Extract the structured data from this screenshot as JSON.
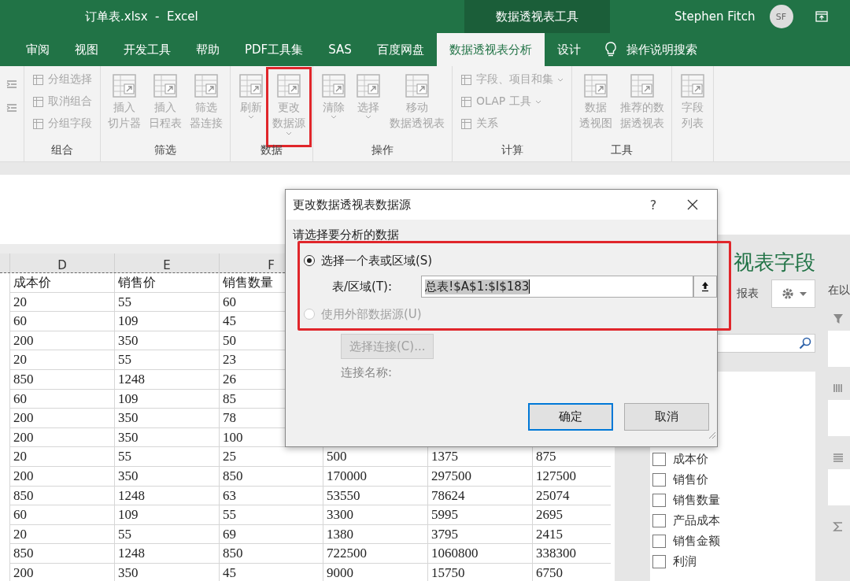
{
  "window": {
    "title": "订单表.xlsx  -  Excel",
    "context_title": "数据透视表工具",
    "user": "Stephen Fitch",
    "avatar": "SF"
  },
  "tabs": [
    {
      "label": "审阅",
      "selected": false
    },
    {
      "label": "视图",
      "selected": false
    },
    {
      "label": "开发工具",
      "selected": false
    },
    {
      "label": "帮助",
      "selected": false
    },
    {
      "label": "PDF工具集",
      "selected": false
    },
    {
      "label": "SAS",
      "selected": false
    },
    {
      "label": "百度网盘",
      "selected": false
    },
    {
      "label": "数据透视表分析",
      "selected": true
    },
    {
      "label": "设计",
      "selected": false
    }
  ],
  "tell_me": "操作说明搜索",
  "ribbon": {
    "groups": [
      {
        "items": [
          {
            "kind": "icon"
          },
          {
            "kind": "icon"
          }
        ]
      },
      {
        "label": "组合",
        "items": [
          {
            "kind": "small",
            "label": "分组选择",
            "disabled": true
          },
          {
            "kind": "small",
            "label": "取消组合",
            "disabled": true
          },
          {
            "kind": "small",
            "label": "分组字段",
            "disabled": true
          }
        ]
      },
      {
        "label": "筛选",
        "items": [
          {
            "kind": "large",
            "lines": [
              "插入",
              "切片器"
            ],
            "disabled": true
          },
          {
            "kind": "large",
            "lines": [
              "插入",
              "日程表"
            ],
            "disabled": true
          },
          {
            "kind": "large",
            "lines": [
              "筛选",
              "器连接"
            ],
            "disabled": true
          }
        ]
      },
      {
        "label": "数据",
        "items": [
          {
            "kind": "large",
            "lines": [
              "刷新"
            ],
            "dropdown": true,
            "disabled": true
          },
          {
            "kind": "large",
            "lines": [
              "更改",
              "数据源"
            ],
            "dropdown": true,
            "disabled": true,
            "highlighted": true
          }
        ]
      },
      {
        "label": "操作",
        "items": [
          {
            "kind": "large",
            "lines": [
              "清除"
            ],
            "dropdown": true,
            "disabled": true
          },
          {
            "kind": "large",
            "lines": [
              "选择"
            ],
            "dropdown": true,
            "disabled": true
          },
          {
            "kind": "large",
            "lines": [
              "移动",
              "数据透视表"
            ],
            "disabled": true
          }
        ]
      },
      {
        "label": "计算",
        "items": [
          {
            "kind": "small",
            "label": "字段、项目和集",
            "dropdown": true,
            "disabled": true
          },
          {
            "kind": "small",
            "label": "OLAP 工具",
            "dropdown": true,
            "disabled": true
          },
          {
            "kind": "small",
            "label": "关系",
            "disabled": true
          }
        ]
      },
      {
        "label": "工具",
        "items": [
          {
            "kind": "large",
            "lines": [
              "数据",
              "透视图"
            ],
            "disabled": true
          },
          {
            "kind": "large",
            "lines": [
              "推荐的数",
              "据透视表"
            ],
            "disabled": true
          }
        ]
      },
      {
        "items": [
          {
            "kind": "large",
            "lines": [
              "字段",
              "列表"
            ],
            "disabled": true
          }
        ]
      }
    ]
  },
  "sheet": {
    "columns": [
      "D",
      "E",
      "F"
    ],
    "rows": [
      [
        "成本价",
        "销售价",
        "销售数量",
        null,
        null,
        null
      ],
      [
        "20",
        "55",
        "60",
        null,
        null,
        null
      ],
      [
        "60",
        "109",
        "45",
        null,
        null,
        null
      ],
      [
        "200",
        "350",
        "50",
        null,
        null,
        null
      ],
      [
        "20",
        "55",
        "23",
        null,
        null,
        null
      ],
      [
        "850",
        "1248",
        "26",
        null,
        null,
        null
      ],
      [
        "60",
        "109",
        "85",
        null,
        null,
        null
      ],
      [
        "200",
        "350",
        "78",
        null,
        null,
        null
      ],
      [
        "200",
        "350",
        "100",
        null,
        null,
        null
      ],
      [
        "20",
        "55",
        "25",
        "500",
        "1375",
        "875"
      ],
      [
        "200",
        "350",
        "850",
        "170000",
        "297500",
        "127500"
      ],
      [
        "850",
        "1248",
        "63",
        "53550",
        "78624",
        "25074"
      ],
      [
        "60",
        "109",
        "55",
        "3300",
        "5995",
        "2695"
      ],
      [
        "20",
        "55",
        "69",
        "1380",
        "3795",
        "2415"
      ],
      [
        "850",
        "1248",
        "850",
        "722500",
        "1060800",
        "338300"
      ],
      [
        "200",
        "350",
        "45",
        "9000",
        "15750",
        "6750"
      ]
    ]
  },
  "field_pane": {
    "title": "视表字段",
    "subtitle": "报表",
    "areas_hint": "在以",
    "fields": [
      {
        "label": "成本价",
        "checked": false
      },
      {
        "label": "销售价",
        "checked": false
      },
      {
        "label": "销售数量",
        "checked": false
      },
      {
        "label": "产品成本",
        "checked": false
      },
      {
        "label": "销售金额",
        "checked": false
      },
      {
        "label": "利润",
        "checked": false
      }
    ]
  },
  "dialog": {
    "title": "更改数据透视表数据源",
    "help": "?",
    "prompt": "请选择要分析的数据",
    "highlighted": true,
    "options": [
      {
        "label": "选择一个表或区域(S)",
        "selected": true,
        "disabled": false
      },
      {
        "label": "使用外部数据源(U)",
        "selected": false,
        "disabled": true
      }
    ],
    "range_label": "表/区域(T):",
    "range_value": "总表!$A$1:$I$183",
    "connection_button": {
      "label": "选择连接(C)...",
      "disabled": true
    },
    "connection_name_label": "连接名称:",
    "buttons": [
      {
        "label": "确定",
        "focused": true
      },
      {
        "label": "取消",
        "focused": false
      }
    ]
  }
}
